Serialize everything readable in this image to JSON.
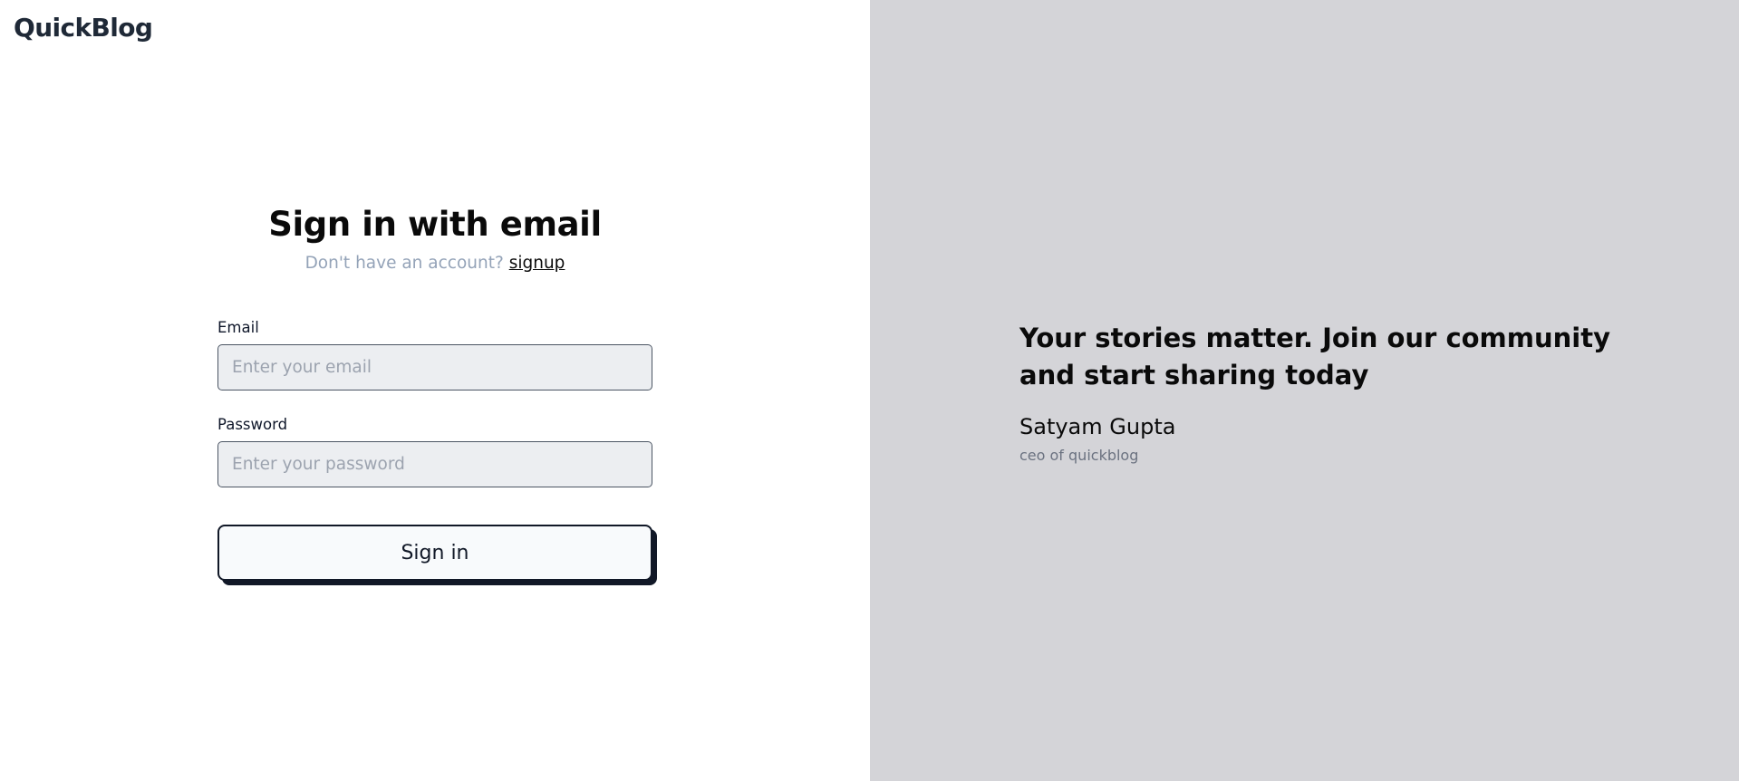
{
  "brand": {
    "name": "QuickBlog"
  },
  "signin": {
    "title": "Sign in with email",
    "prompt_text": "Don't have an account?",
    "signup_link": "signup",
    "email_label": "Email",
    "email_placeholder": "Enter your email",
    "email_value": "",
    "password_label": "Password",
    "password_placeholder": "Enter your password",
    "password_value": "",
    "submit_label": "Sign in"
  },
  "testimonial": {
    "quote": "Your stories matter. Join our community and start sharing today",
    "author": "Satyam Gupta",
    "role": "ceo of quickblog"
  },
  "colors": {
    "left_background": "#ffffff",
    "right_background": "#d4d4d8",
    "input_background": "#eceef1",
    "button_background": "#f8fafc",
    "button_shadow": "#111827",
    "muted_text": "#94a3b8",
    "brand_text": "#1f2937"
  }
}
